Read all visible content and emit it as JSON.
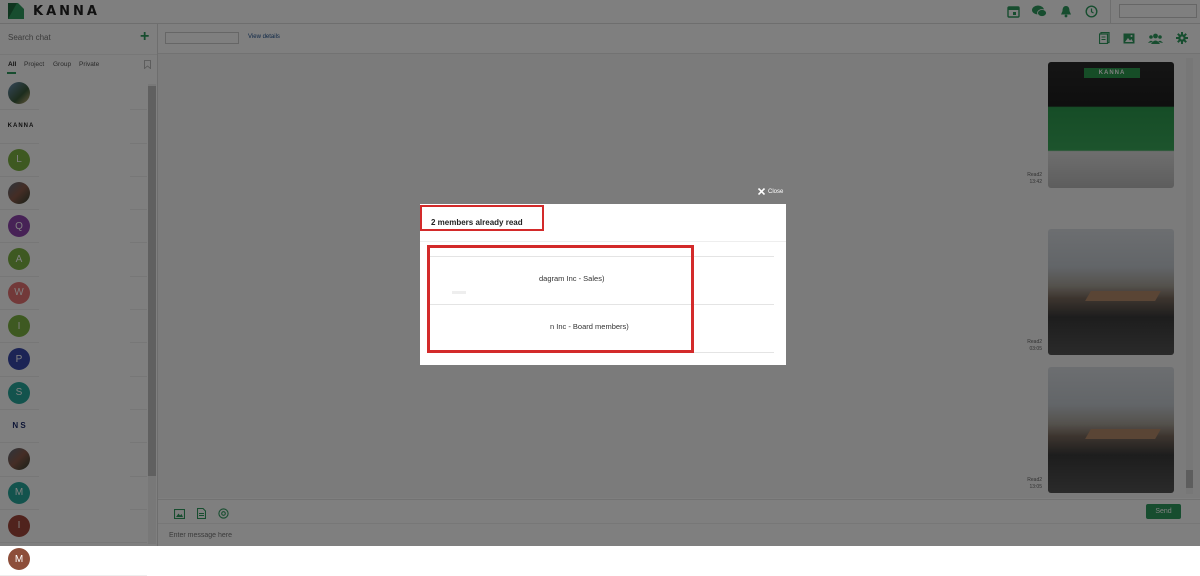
{
  "app": {
    "brand": "KANNA",
    "accent": "#2e9b5f",
    "highlight_color": "#d32a2a"
  },
  "topbar": {
    "icons": [
      "calendar-icon",
      "chat-icon",
      "bell-icon",
      "clock-icon"
    ]
  },
  "sidebar": {
    "search_placeholder": "Search chat",
    "add_label": "+",
    "filters": [
      "All",
      "Project",
      "Group",
      "Private"
    ],
    "chats": [
      {
        "type": "photo",
        "initial": ""
      },
      {
        "type": "kanna",
        "initial": "KANNA"
      },
      {
        "type": "letter",
        "initial": "L",
        "color": "#7cb342"
      },
      {
        "type": "photo2",
        "initial": ""
      },
      {
        "type": "letter",
        "initial": "Q",
        "color": "#8e44ad"
      },
      {
        "type": "letter",
        "initial": "A",
        "color": "#7cb342"
      },
      {
        "type": "letter",
        "initial": "W",
        "color": "#e57373"
      },
      {
        "type": "letter",
        "initial": "I",
        "color": "#7cb342"
      },
      {
        "type": "letter",
        "initial": "P",
        "color": "#3949ab"
      },
      {
        "type": "letter",
        "initial": "S",
        "color": "#26a69a"
      },
      {
        "type": "ns",
        "initial": "N S"
      },
      {
        "type": "photo2",
        "initial": ""
      },
      {
        "type": "letter",
        "initial": "M",
        "color": "#26a69a"
      },
      {
        "type": "letter",
        "initial": "I",
        "color": "#a1463a"
      },
      {
        "type": "letter",
        "initial": "M",
        "color": "#8d4e3a"
      }
    ]
  },
  "chat_header": {
    "view_details": "View details",
    "icons": [
      "document-icon",
      "image-icon",
      "members-icon",
      "settings-icon"
    ]
  },
  "messages": [
    {
      "kind": "photo",
      "caption": "KANNA",
      "read": "Read2",
      "time": "13:42"
    },
    {
      "kind": "photo",
      "read": "Read2",
      "time": "03:05"
    },
    {
      "kind": "photo",
      "read": "Read2",
      "time": "13:05"
    }
  ],
  "composer": {
    "placeholder": "Enter message here",
    "send_label": "Send",
    "tools": [
      "image-icon",
      "file-icon",
      "mention-icon"
    ]
  },
  "modal": {
    "close_label": "Close",
    "title": "2 members already read",
    "readers": [
      {
        "name": "dagram Inc - Sales)"
      },
      {
        "name": "n Inc - Board members)"
      }
    ]
  }
}
